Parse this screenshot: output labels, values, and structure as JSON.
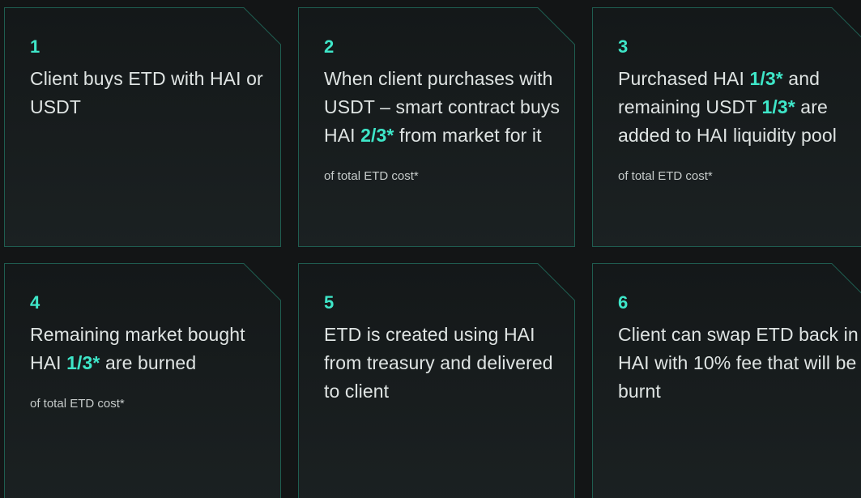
{
  "accent_color": "#3ee6c8",
  "background_color": "#131516",
  "border_color": "#1f5d50",
  "steps": [
    {
      "number": "1",
      "parts": [
        {
          "t": "Client buys ETD with HAI or USDT",
          "hl": false
        }
      ],
      "note": ""
    },
    {
      "number": "2",
      "parts": [
        {
          "t": "When client purchases with USDT – smart contract buys HAI ",
          "hl": false
        },
        {
          "t": "2/3*",
          "hl": true
        },
        {
          "t": " from market for it",
          "hl": false
        }
      ],
      "note": "of total ETD cost*"
    },
    {
      "number": "3",
      "parts": [
        {
          "t": "Purchased HAI ",
          "hl": false
        },
        {
          "t": "1/3*",
          "hl": true
        },
        {
          "t": " and remaining USDT ",
          "hl": false
        },
        {
          "t": "1/3*",
          "hl": true
        },
        {
          "t": " are added to HAI liquidity pool",
          "hl": false
        }
      ],
      "note": "of total ETD cost*"
    },
    {
      "number": "4",
      "parts": [
        {
          "t": "Remaining market bought HAI ",
          "hl": false
        },
        {
          "t": "1/3*",
          "hl": true
        },
        {
          "t": " are burned",
          "hl": false
        }
      ],
      "note": "of total ETD cost*"
    },
    {
      "number": "5",
      "parts": [
        {
          "t": "ETD is created using HAI from treasury and delivered to client",
          "hl": false
        }
      ],
      "note": ""
    },
    {
      "number": "6",
      "parts": [
        {
          "t": "Client can swap ETD back in HAI with 10% fee that will be burnt",
          "hl": false
        }
      ],
      "note": ""
    }
  ]
}
